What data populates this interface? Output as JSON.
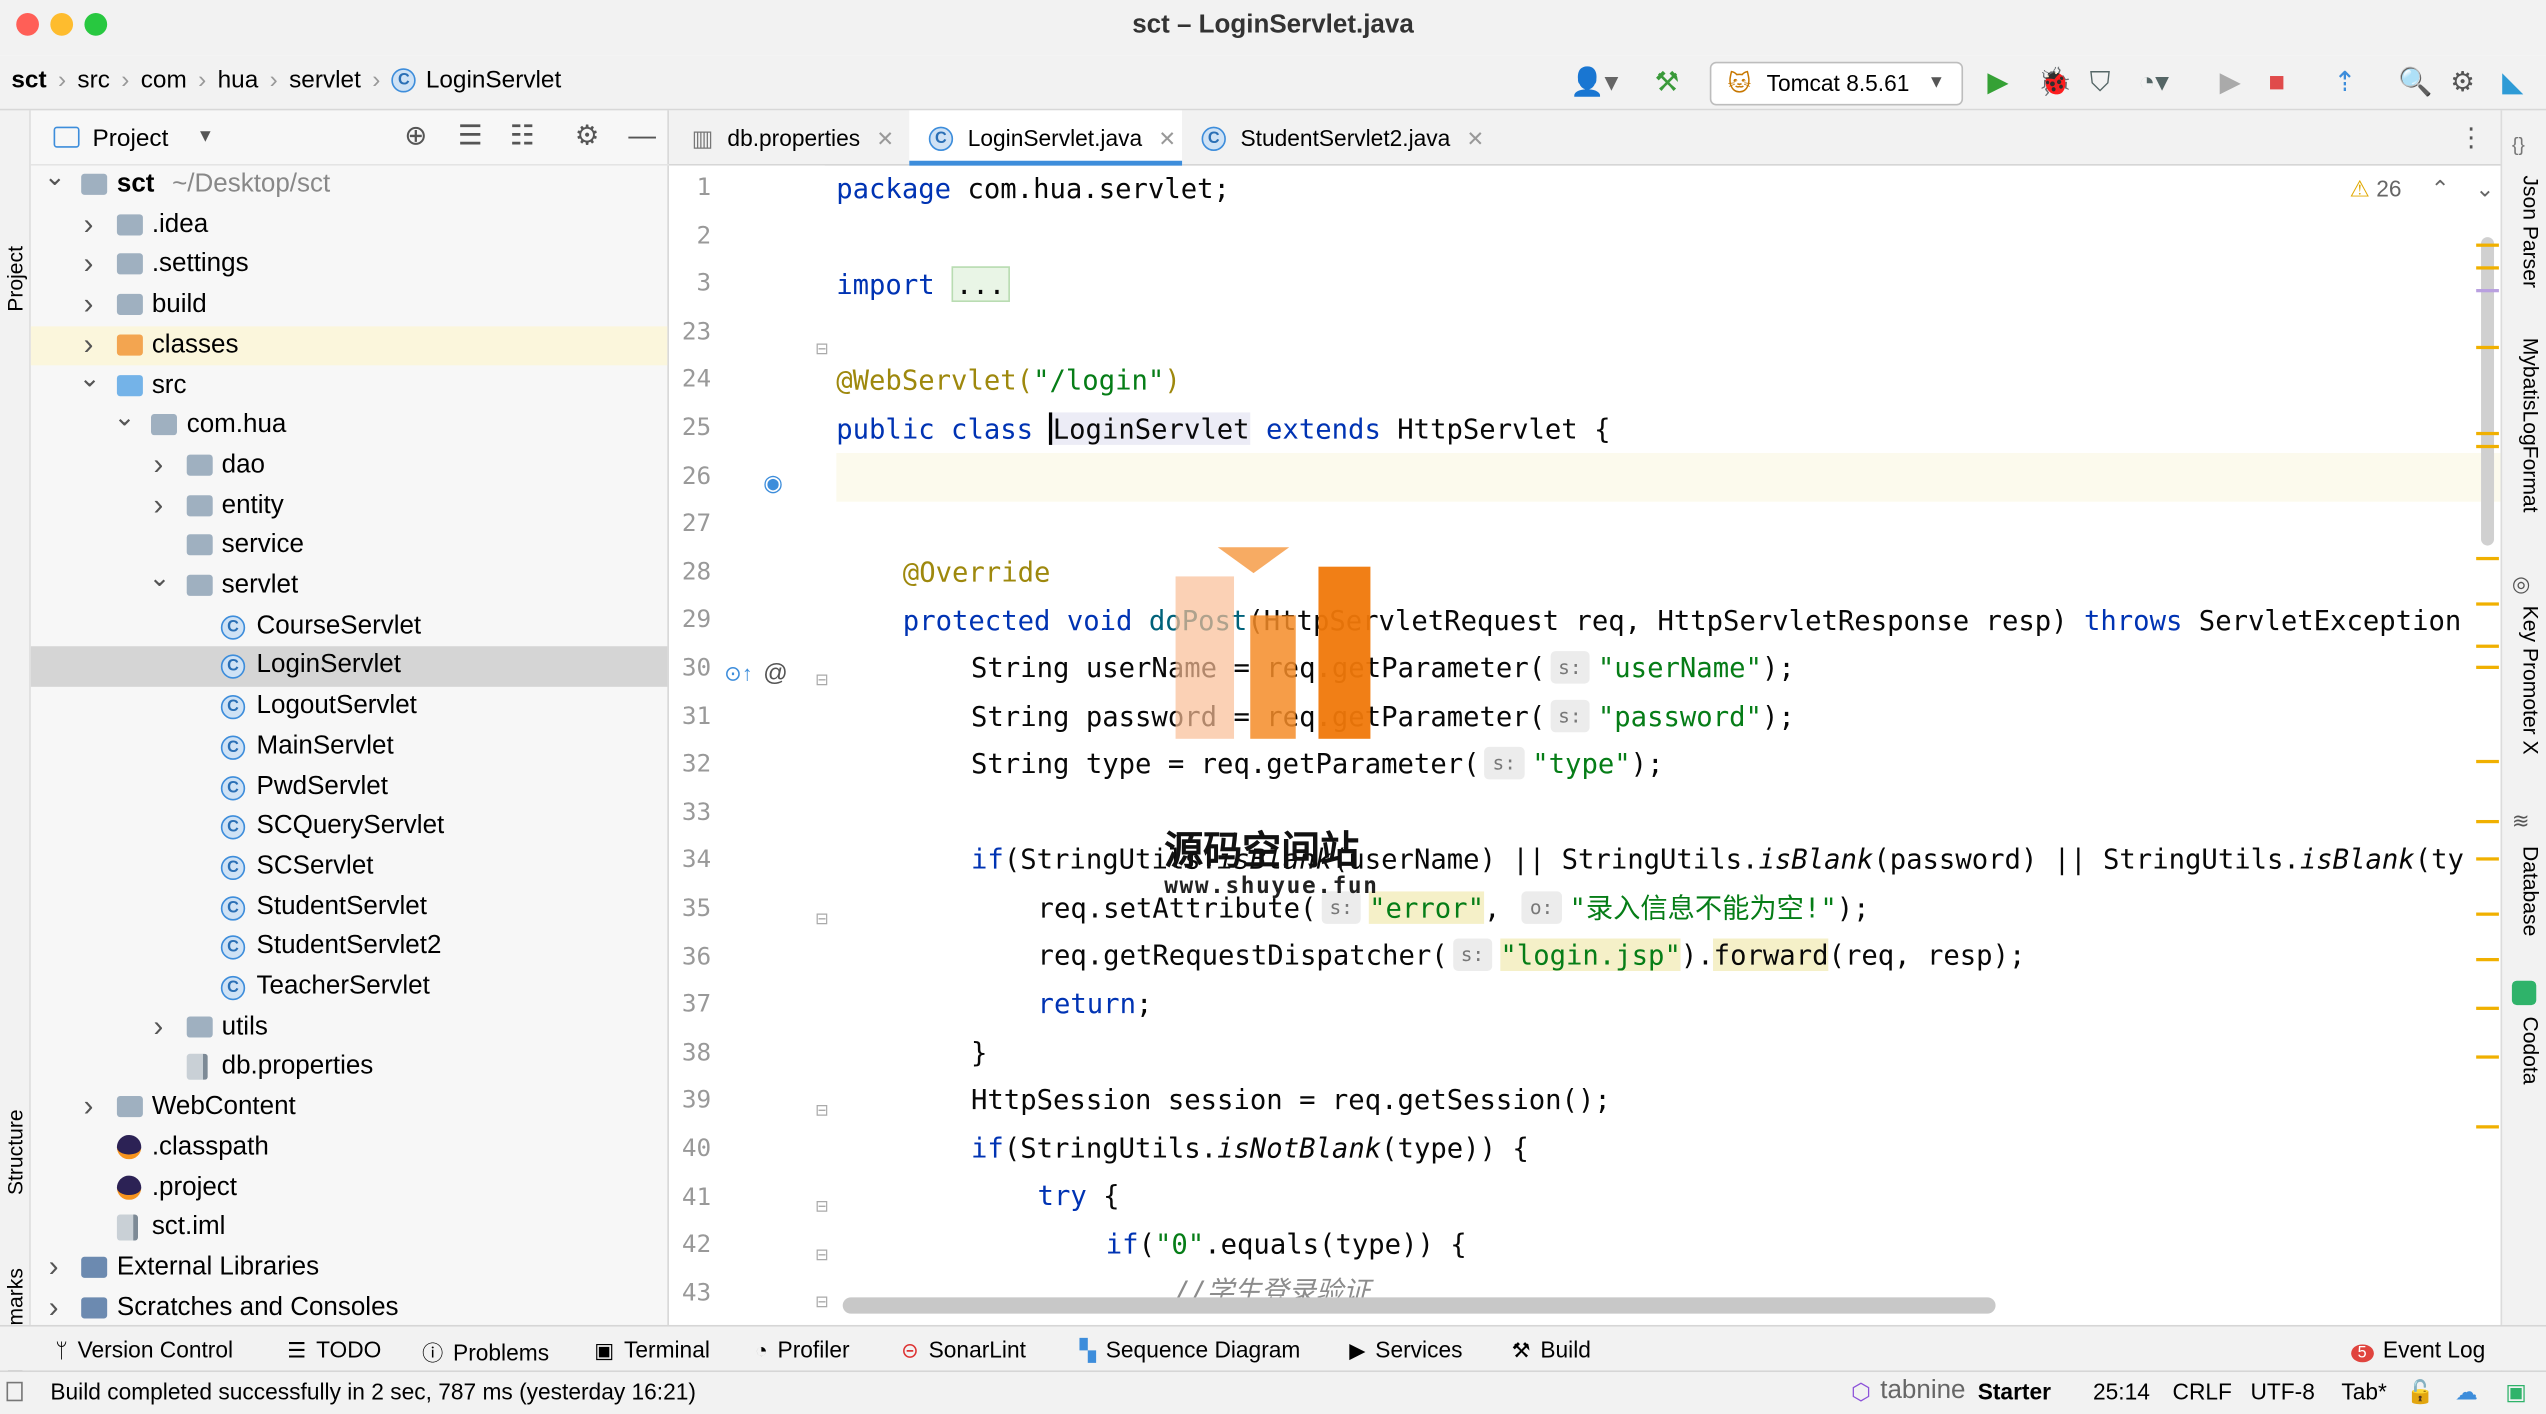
{
  "window": {
    "title": "sct – LoginServlet.java"
  },
  "breadcrumb": [
    "sct",
    "src",
    "com",
    "hua",
    "servlet",
    "LoginServlet"
  ],
  "toolbar": {
    "run_config": "Tomcat 8.5.61"
  },
  "project_panel": {
    "title": "Project",
    "tree": [
      {
        "label": "sct",
        "suffix": "~/Desktop/sct",
        "depth": 0,
        "expanded": true,
        "kind": "module"
      },
      {
        "label": ".idea",
        "depth": 1,
        "collapsed": true,
        "kind": "folder"
      },
      {
        "label": ".settings",
        "depth": 1,
        "collapsed": true,
        "kind": "folder"
      },
      {
        "label": "build",
        "depth": 1,
        "collapsed": true,
        "kind": "folder"
      },
      {
        "label": "classes",
        "depth": 1,
        "collapsed": true,
        "kind": "folder-orange",
        "highlight": true
      },
      {
        "label": "src",
        "depth": 1,
        "expanded": true,
        "kind": "folder-src"
      },
      {
        "label": "com.hua",
        "depth": 2,
        "expanded": true,
        "kind": "package"
      },
      {
        "label": "dao",
        "depth": 3,
        "collapsed": true,
        "kind": "package"
      },
      {
        "label": "entity",
        "depth": 3,
        "collapsed": true,
        "kind": "package"
      },
      {
        "label": "service",
        "depth": 3,
        "kind": "package"
      },
      {
        "label": "servlet",
        "depth": 3,
        "expanded": true,
        "kind": "package"
      },
      {
        "label": "CourseServlet",
        "depth": 4,
        "kind": "class"
      },
      {
        "label": "LoginServlet",
        "depth": 4,
        "kind": "class",
        "selected": true
      },
      {
        "label": "LogoutServlet",
        "depth": 4,
        "kind": "class"
      },
      {
        "label": "MainServlet",
        "depth": 4,
        "kind": "class"
      },
      {
        "label": "PwdServlet",
        "depth": 4,
        "kind": "class"
      },
      {
        "label": "SCQueryServlet",
        "depth": 4,
        "kind": "class"
      },
      {
        "label": "SCServlet",
        "depth": 4,
        "kind": "class"
      },
      {
        "label": "StudentServlet",
        "depth": 4,
        "kind": "class"
      },
      {
        "label": "StudentServlet2",
        "depth": 4,
        "kind": "class"
      },
      {
        "label": "TeacherServlet",
        "depth": 4,
        "kind": "class"
      },
      {
        "label": "utils",
        "depth": 3,
        "collapsed": true,
        "kind": "package"
      },
      {
        "label": "db.properties",
        "depth": 3,
        "kind": "props"
      },
      {
        "label": "WebContent",
        "depth": 1,
        "collapsed": true,
        "kind": "folder-web"
      },
      {
        "label": ".classpath",
        "depth": 1,
        "kind": "eclipse"
      },
      {
        "label": ".project",
        "depth": 1,
        "kind": "eclipse"
      },
      {
        "label": "sct.iml",
        "depth": 1,
        "kind": "iml"
      },
      {
        "label": "External Libraries",
        "depth": 0,
        "collapsed": true,
        "kind": "libs"
      },
      {
        "label": "Scratches and Consoles",
        "depth": 0,
        "collapsed": true,
        "kind": "scratch"
      }
    ]
  },
  "editor": {
    "tabs": [
      {
        "label": "db.properties",
        "active": false
      },
      {
        "label": "LoginServlet.java",
        "active": true
      },
      {
        "label": "StudentServlet2.java",
        "active": false
      }
    ],
    "warning_count": "26",
    "line_numbers": [
      "1",
      "2",
      "3",
      "23",
      "24",
      "25",
      "26",
      "27",
      "28",
      "29",
      "30",
      "31",
      "32",
      "33",
      "34",
      "35",
      "36",
      "37",
      "38",
      "39",
      "40",
      "41",
      "42",
      "43"
    ],
    "lines": {
      "l1": {
        "kw": "package",
        "rest": " com.hua.servlet;"
      },
      "l3": {
        "kw": "import",
        "fold": "..."
      },
      "l24": {
        "ann": "@WebServlet(",
        "str": "\"/login\"",
        "close": ")"
      },
      "l25": {
        "kw1": "public class ",
        "name": "LoginServlet",
        "kw2": " extends ",
        "sup": "HttpServlet {"
      },
      "l28": {
        "ann": "@Override"
      },
      "l29": {
        "kw": "protected void ",
        "fn": "doPost",
        "a": "(HttpServletRequest req, HttpServletResponse resp) ",
        "kw2": "throws",
        "b": " ServletException"
      },
      "l30": {
        "a": "String userName = req.getParameter(",
        "hint": "s:",
        "str": "\"userName\"",
        "b": ");"
      },
      "l31": {
        "a": "String password = req.getParameter(",
        "hint": "s:",
        "str": "\"password\"",
        "b": ");"
      },
      "l32": {
        "a": "String type = req.getParameter(",
        "hint": "s:",
        "str": "\"type\"",
        "b": ");"
      },
      "l34": {
        "kw": "if",
        "a": "(StringUtils.",
        "m1": "isBlank",
        "b": "(userName) || StringUtils.",
        "m2": "isBlank",
        "c": "(password) || StringUtils.",
        "m3": "isBlank",
        "d": "(ty"
      },
      "l35": {
        "a": "req.setAttribute(",
        "hint1": "s:",
        "str1": "\"error\"",
        "b": ", ",
        "hint2": "o:",
        "str2": "\"录入信息不能为空!\"",
        "c": ");"
      },
      "l36": {
        "a": "req.getRequestDispatcher(",
        "hint": "s:",
        "str": "\"login.jsp\"",
        "b": ").",
        "fn": "forward",
        "c": "(req, resp);"
      },
      "l37": {
        "kw": "return",
        "a": ";"
      },
      "l38": {
        "a": "}"
      },
      "l39": {
        "a": "HttpSession session = req.getSession();"
      },
      "l40": {
        "kw": "if",
        "a": "(StringUtils.",
        "m": "isNotBlank",
        "b": "(type)) {"
      },
      "l41": {
        "kw": "try",
        "a": " {"
      },
      "l42": {
        "kw": "if",
        "a": "(",
        "str": "\"0\"",
        "b": ".equals(type)) {"
      },
      "l43": {
        "cm": "//学生登录验证"
      }
    }
  },
  "watermark": {
    "title": "源码空间站",
    "url": "www.shuyue.fun"
  },
  "left_tools": [
    "Project",
    "Structure",
    "Bookmarks"
  ],
  "right_tools": [
    "Json Parser",
    "MybatisLogFormat",
    "Key Promoter X",
    "Database",
    "Codota"
  ],
  "bottom_tools": [
    "Version Control",
    "TODO",
    "Problems",
    "Terminal",
    "Profiler",
    "SonarLint",
    "Sequence Diagram",
    "Services",
    "Build",
    "Event Log"
  ],
  "status": {
    "message": "Build completed successfully in 2 sec, 787 ms (yesterday 16:21)",
    "plugin": "tabnine",
    "plugin_tier": "Starter",
    "position": "25:14",
    "line_sep": "CRLF",
    "encoding": "UTF-8",
    "indent": "Tab*"
  },
  "colors": {
    "keyword": "#0033b3",
    "string": "#067d17",
    "annotation": "#9e880d",
    "selection": "#d5d5d5",
    "accent": "#3d8ddb"
  }
}
